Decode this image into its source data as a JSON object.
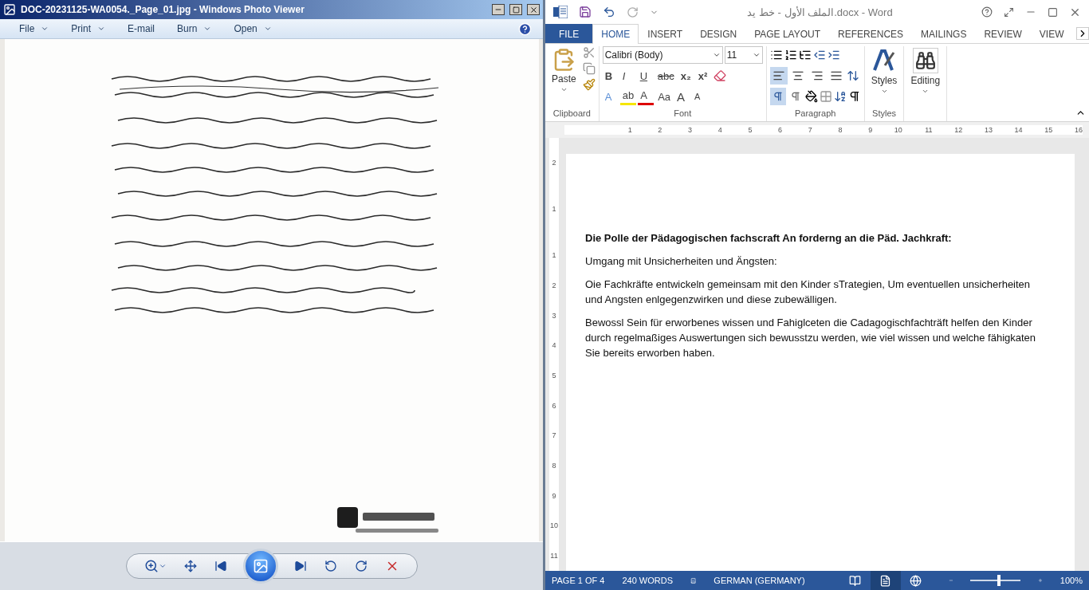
{
  "photo_viewer": {
    "title": "DOC-20231125-WA0054._Page_01.jpg - Windows Photo Viewer",
    "menu": [
      {
        "label": "File",
        "dropdown": true
      },
      {
        "label": "Print",
        "dropdown": true
      },
      {
        "label": "E-mail",
        "dropdown": false
      },
      {
        "label": "Burn",
        "dropdown": true
      },
      {
        "label": "Open",
        "dropdown": true
      }
    ]
  },
  "word": {
    "title": "الملف الأول - خط يد.docx - Word",
    "tabs": [
      {
        "label": "FILE",
        "kind": "file",
        "selected": false
      },
      {
        "label": "HOME",
        "kind": "tab",
        "selected": true
      },
      {
        "label": "INSERT",
        "kind": "tab",
        "selected": false
      },
      {
        "label": "DESIGN",
        "kind": "tab",
        "selected": false
      },
      {
        "label": "PAGE LAYOUT",
        "kind": "tab",
        "selected": false
      },
      {
        "label": "REFERENCES",
        "kind": "tab",
        "selected": false
      },
      {
        "label": "MAILINGS",
        "kind": "tab",
        "selected": false
      },
      {
        "label": "REVIEW",
        "kind": "tab",
        "selected": false
      },
      {
        "label": "VIEW",
        "kind": "tab",
        "selected": false
      }
    ],
    "ribbon": {
      "paste_label": "Paste",
      "font_name": "Calibri (Body)",
      "font_size": "11",
      "font_row1": [
        "B",
        "I",
        "U",
        "abc",
        "x₂",
        "x²"
      ],
      "font_row2": [
        "A",
        "ab",
        "A",
        "Aa",
        "A",
        "A"
      ],
      "alignment": [
        {
          "kind": "left",
          "selected": true
        },
        {
          "kind": "center",
          "selected": false
        },
        {
          "kind": "right",
          "selected": false
        },
        {
          "kind": "justify",
          "selected": false
        }
      ],
      "direction": [
        {
          "kind": "ltr",
          "selected": true
        },
        {
          "kind": "rtl",
          "selected": false
        }
      ],
      "styles_label": "Styles",
      "editing_label": "Editing",
      "groups": [
        "Clipboard",
        "Font",
        "Paragraph",
        "Styles"
      ]
    },
    "ruler": {
      "horizontal": [
        "1",
        "2",
        "3",
        "4",
        "5",
        "6",
        "7",
        "8",
        "9",
        "10",
        "11",
        "12",
        "13",
        "14",
        "15",
        "16"
      ],
      "vertical": [
        "2",
        "1",
        "1",
        "2",
        "3",
        "4",
        "5",
        "6",
        "7",
        "8",
        "9",
        "10",
        "11"
      ]
    },
    "document": [
      {
        "text": "Die Polle der Pädagogischen fachscraft An forderng an die Päd. Jachkraft:",
        "bold": true
      },
      {
        "text": "Umgang mit Unsicherheiten und Ängsten:",
        "bold": false
      },
      {
        "text": "Oie Fachkräfte entwickeln gemeinsam mit den Kinder sTrategien, Um eventuellen unsicherheiten und Angsten enlgegenzwirken und diese zubewälligen.",
        "bold": false
      },
      {
        "text": "Bewossl Sein für erworbenes wissen und Fahiglceten die Cadagogischfachträft helfen den Kinder durch regelmaßiges Auswertungen sich bewusstzu werden, wie viel wissen und welche fähigkaten Sie bereits erworben haben.",
        "bold": false
      }
    ],
    "status_bar": {
      "page": "PAGE 1 OF 4",
      "words": "240 WORDS",
      "language": "GERMAN (GERMANY)",
      "views": [
        {
          "kind": "read",
          "selected": false
        },
        {
          "kind": "print",
          "selected": true
        },
        {
          "kind": "web",
          "selected": false
        }
      ],
      "zoom_slider": {
        "level": 0.57
      },
      "zoom": "100%"
    }
  }
}
